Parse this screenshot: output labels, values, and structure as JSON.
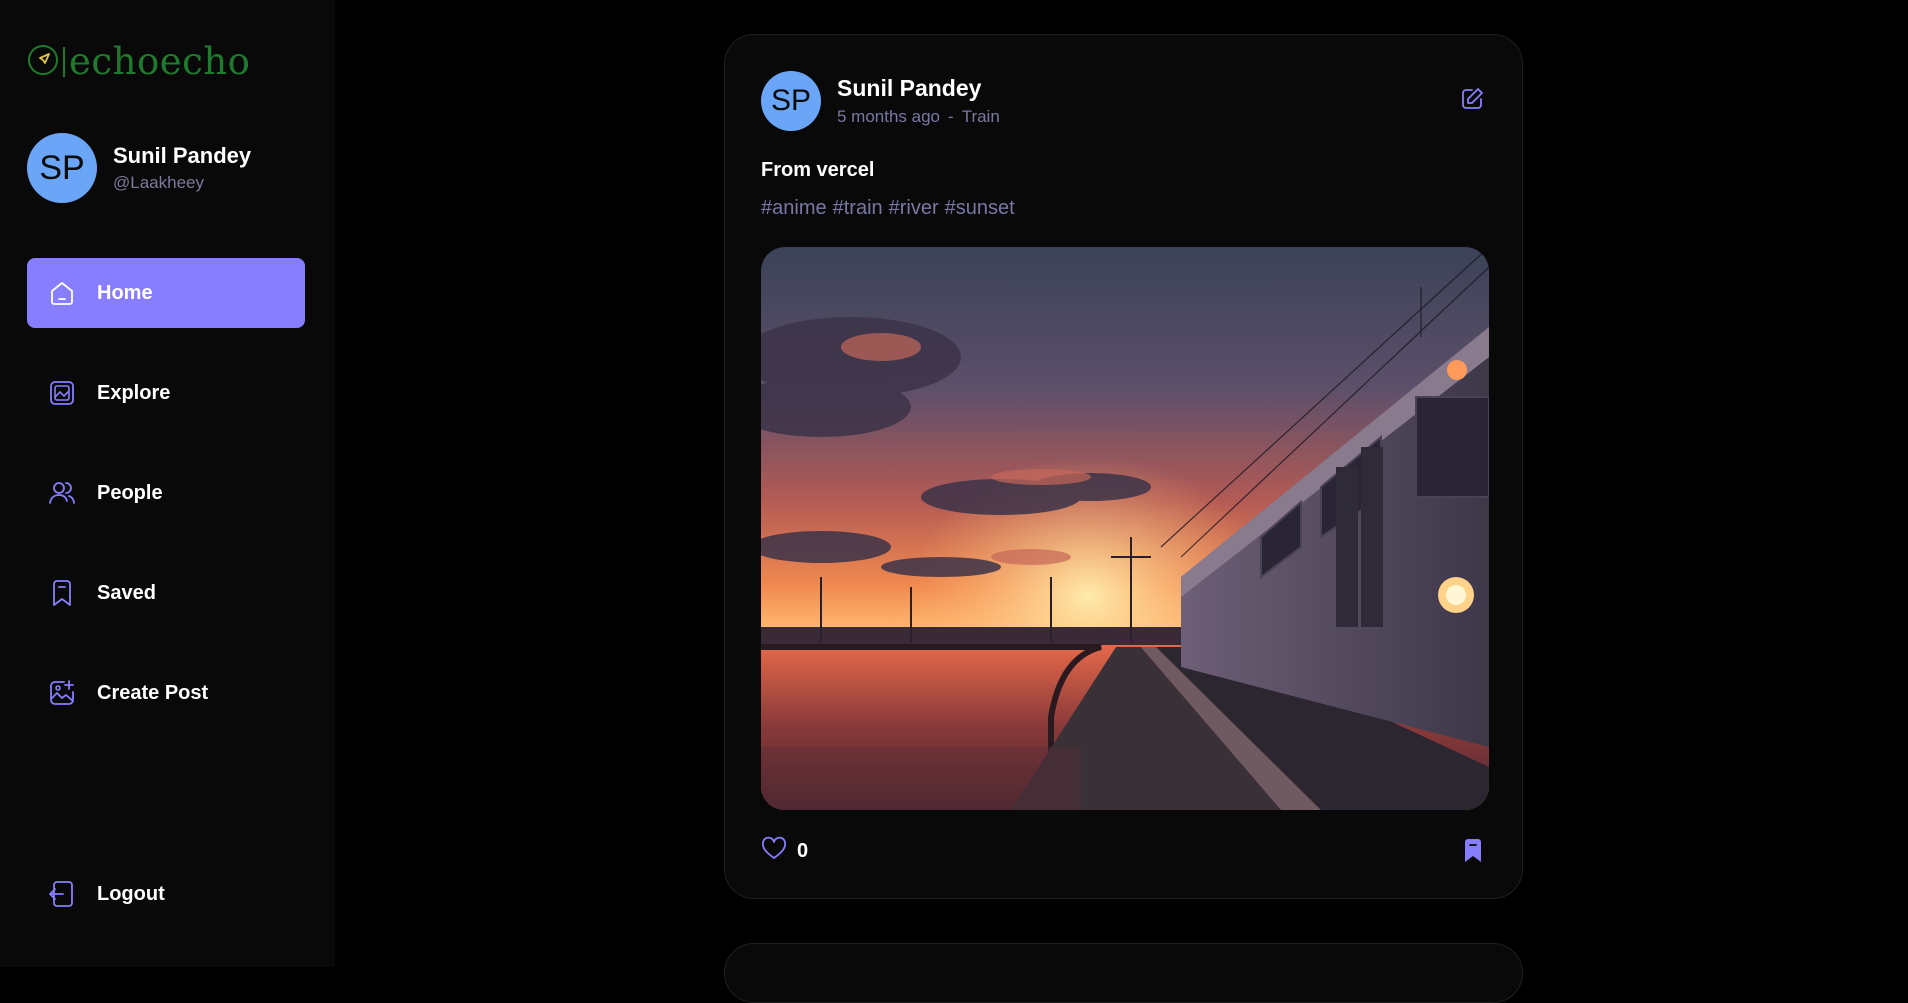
{
  "app": {
    "name": "echoecho",
    "brand_color": "#1f7a2e",
    "accent_color": "#877eff"
  },
  "user": {
    "initials": "SP",
    "name": "Sunil Pandey",
    "handle": "@Laakheey"
  },
  "nav": {
    "items": [
      {
        "label": "Home",
        "icon": "home-icon",
        "active": true
      },
      {
        "label": "Explore",
        "icon": "gallery-icon",
        "active": false
      },
      {
        "label": "People",
        "icon": "people-icon",
        "active": false
      },
      {
        "label": "Saved",
        "icon": "bookmark-icon",
        "active": false
      },
      {
        "label": "Create Post",
        "icon": "add-image-icon",
        "active": false
      }
    ],
    "logout_label": "Logout"
  },
  "post": {
    "author_initials": "SP",
    "author": "Sunil Pandey",
    "time": "5 months ago",
    "separator": "-",
    "location": "Train",
    "caption": "From vercel",
    "tags": [
      "#anime",
      "#train",
      "#river",
      "#sunset"
    ],
    "likes": "0"
  }
}
